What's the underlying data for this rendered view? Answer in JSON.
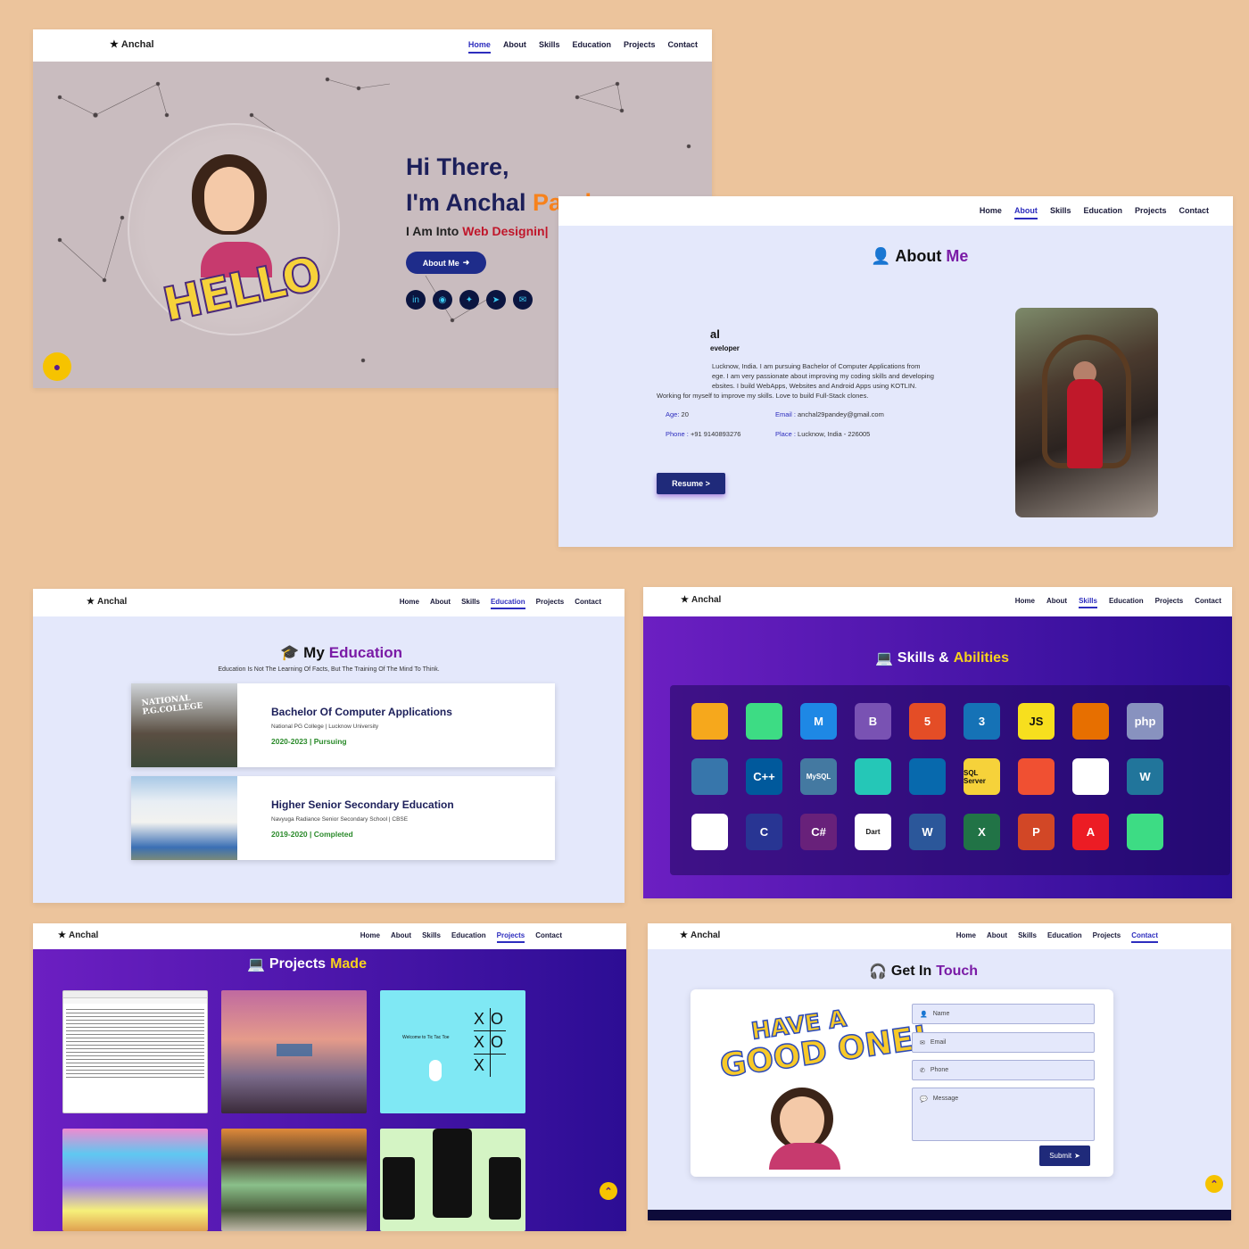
{
  "brand": "Anchal",
  "nav": [
    "Home",
    "About",
    "Skills",
    "Education",
    "Projects",
    "Contact"
  ],
  "hero": {
    "greeting": "Hi There,",
    "name_prefix": "I'm Anchal ",
    "name_accent": "Pandey",
    "sub_prefix": "I Am Into ",
    "sub_accent": "Web Designin|",
    "button": "About Me",
    "hello_art": "HELLO",
    "socials": [
      "linkedin-icon",
      "github-icon",
      "twitter-icon",
      "telegram-icon",
      "mail-icon"
    ],
    "active_nav": "Home"
  },
  "about": {
    "title_prefix": "About ",
    "title_accent": "Me",
    "name_fragment": "al",
    "role_fragment": "eveloper",
    "bio_lines": [
      "Lucknow, India. I am pursuing Bachelor of Computer Applications from",
      "ege. I am very passionate about improving my coding skills and developing",
      "ebsites. I build WebApps, Websites and Android Apps using KOTLIN.",
      "Working for myself to improve my skills. Love to build Full-Stack clones."
    ],
    "age_label": "Age:",
    "age_value": "20",
    "email_label": "Email :",
    "email_value": "anchal29pandey@gmail.com",
    "phone_label": "Phone :",
    "phone_value": "+91 9140893276",
    "place_label": "Place :",
    "place_value": "Lucknow, India - 226005",
    "resume_button": "Resume >",
    "active_nav": "About"
  },
  "education": {
    "title_prefix": "My ",
    "title_accent": "Education",
    "subtitle": "Education Is Not The Learning Of Facts, But The Training Of The Mind To Think.",
    "items": [
      {
        "degree": "Bachelor Of Computer Applications",
        "school": "National PG College | Lucknow University",
        "years": "2020-2023 | Pursuing",
        "sign": "NATIONAL P.G.COLLEGE"
      },
      {
        "degree": "Higher Senior Secondary Education",
        "school": "Navyuga Radiance Senior Secondary School | CBSE",
        "years": "2019-2020 | Completed"
      }
    ],
    "active_nav": "Education"
  },
  "skills": {
    "title_prefix": "Skills & ",
    "title_accent": "Abilities",
    "items": [
      {
        "name": "firebase-icon",
        "label": "",
        "color": "#f6a81c"
      },
      {
        "name": "android-icon",
        "label": "",
        "color": "#3ddc84"
      },
      {
        "name": "material-ui-icon",
        "label": "M",
        "color": "#1e88e5"
      },
      {
        "name": "bootstrap-icon",
        "label": "B",
        "color": "#7952b3"
      },
      {
        "name": "html5-icon",
        "label": "5",
        "color": "#e44d26"
      },
      {
        "name": "css3-icon",
        "label": "3",
        "color": "#1572b6"
      },
      {
        "name": "javascript-icon",
        "label": "JS",
        "color": "#f7df1e"
      },
      {
        "name": "java-icon",
        "label": "",
        "color": "#e76f00"
      },
      {
        "name": "php-icon",
        "label": "php",
        "color": "#8892bf"
      },
      {
        "name": "python-icon",
        "label": "",
        "color": "#3776ab"
      },
      {
        "name": "cpp-icon",
        "label": "C++",
        "color": "#00599c"
      },
      {
        "name": "mysql-icon",
        "label": "MySQL",
        "color": "#4479a1"
      },
      {
        "name": "netlify-icon",
        "label": "",
        "color": "#25c7b7"
      },
      {
        "name": "jquery-icon",
        "label": "",
        "color": "#0769ad"
      },
      {
        "name": "sql-server-icon",
        "label": "SQL Server",
        "color": "#f6d23a"
      },
      {
        "name": "git-icon",
        "label": "",
        "color": "#f05032"
      },
      {
        "name": "github-icon",
        "label": "",
        "color": "#ffffff"
      },
      {
        "name": "wordpress-icon",
        "label": "W",
        "color": "#21759b"
      },
      {
        "name": "flutter-icon",
        "label": "",
        "color": "#ffffff"
      },
      {
        "name": "c-icon",
        "label": "C",
        "color": "#283593"
      },
      {
        "name": "csharp-icon",
        "label": "C#",
        "color": "#68217a"
      },
      {
        "name": "dart-icon",
        "label": "Dart",
        "color": "#ffffff"
      },
      {
        "name": "word-icon",
        "label": "W",
        "color": "#2b579a"
      },
      {
        "name": "excel-icon",
        "label": "X",
        "color": "#217346"
      },
      {
        "name": "powerpoint-icon",
        "label": "P",
        "color": "#d24726"
      },
      {
        "name": "acrobat-icon",
        "label": "A",
        "color": "#ec1c24"
      },
      {
        "name": "android-studio-icon",
        "label": "",
        "color": "#3ddc84"
      }
    ],
    "active_nav": "Skills"
  },
  "projects": {
    "title_prefix": "Projects ",
    "title_accent": "Made",
    "tic_tac_toe_text": "Welcome to Tic Tac Toe",
    "tic_tac_toe_board": [
      "X",
      "O",
      "X",
      "O",
      "X",
      ""
    ],
    "active_nav": "Projects"
  },
  "contact": {
    "title_prefix": "Get In ",
    "title_accent": "Touch",
    "art_line1": "HAVE A",
    "art_line2": "GOOD ONE!",
    "placeholders": [
      "Name",
      "Email",
      "Phone",
      "Message"
    ],
    "submit": "Submit",
    "active_nav": "Contact"
  }
}
